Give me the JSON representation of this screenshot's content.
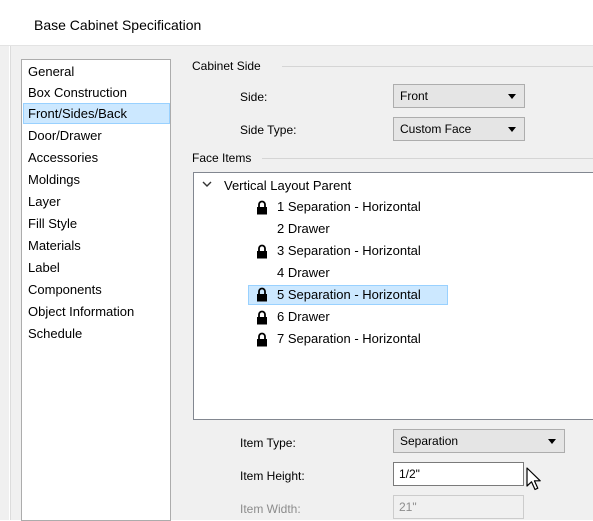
{
  "window": {
    "title": "Base Cabinet Specification"
  },
  "nav": {
    "items": [
      {
        "label": "General",
        "selected": false
      },
      {
        "label": "Box Construction",
        "selected": false
      },
      {
        "label": "Front/Sides/Back",
        "selected": true
      },
      {
        "label": "Door/Drawer",
        "selected": false
      },
      {
        "label": "Accessories",
        "selected": false
      },
      {
        "label": "Moldings",
        "selected": false
      },
      {
        "label": "Layer",
        "selected": false
      },
      {
        "label": "Fill Style",
        "selected": false
      },
      {
        "label": "Materials",
        "selected": false
      },
      {
        "label": "Label",
        "selected": false
      },
      {
        "label": "Components",
        "selected": false
      },
      {
        "label": "Object Information",
        "selected": false
      },
      {
        "label": "Schedule",
        "selected": false
      }
    ]
  },
  "cabinet_side": {
    "group_label": "Cabinet Side",
    "side_label": "Side:",
    "side_value": "Front",
    "side_type_label": "Side Type:",
    "side_type_value": "Custom Face"
  },
  "face_items": {
    "group_label": "Face Items",
    "parent_label": "Vertical Layout Parent",
    "items": [
      {
        "label": "1 Separation - Horizontal",
        "locked": true,
        "selected": false
      },
      {
        "label": "2 Drawer",
        "locked": false,
        "selected": false
      },
      {
        "label": "3 Separation - Horizontal",
        "locked": true,
        "selected": false
      },
      {
        "label": "4 Drawer",
        "locked": false,
        "selected": false
      },
      {
        "label": "5 Separation - Horizontal",
        "locked": true,
        "selected": true
      },
      {
        "label": "6 Drawer",
        "locked": true,
        "selected": false
      },
      {
        "label": "7 Separation - Horizontal",
        "locked": true,
        "selected": false
      }
    ]
  },
  "item_props": {
    "type_label": "Item Type:",
    "type_value": "Separation",
    "height_label": "Item Height:",
    "height_value": "1/2\"",
    "width_label": "Item Width:",
    "width_value": "21\""
  },
  "colors": {
    "selection_bg": "#cce8ff",
    "selection_border": "#99d1ff",
    "dialog_bg": "#f0f0f0"
  }
}
